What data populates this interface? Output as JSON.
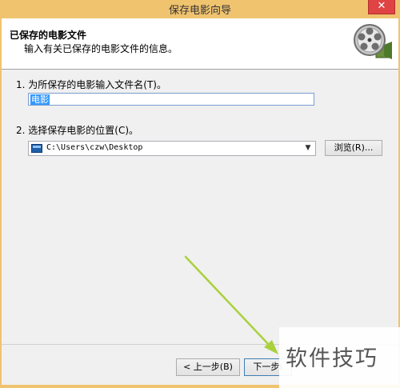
{
  "window": {
    "title": "保存电影向导",
    "close_glyph": "✕"
  },
  "header": {
    "title": "已保存的电影文件",
    "subtitle": "输入有关已保存的电影文件的信息。",
    "icon": "film-reel-icon"
  },
  "step1": {
    "label": "1. 为所保存的电影输入文件名(T)。",
    "value": "电影"
  },
  "step2": {
    "label": "2. 选择保存电影的位置(C)。",
    "location": "C:\\Users\\czw\\Desktop",
    "browse_label": "浏览(R)..."
  },
  "footer": {
    "back_label": "< 上一步(B)",
    "next_label": "下一步("
  },
  "watermark": {
    "text": "软件技巧"
  },
  "colors": {
    "titlebar": "#f0c36f",
    "close": "#e04343",
    "arrow": "#a9d13c",
    "selection": "#3399ff"
  }
}
